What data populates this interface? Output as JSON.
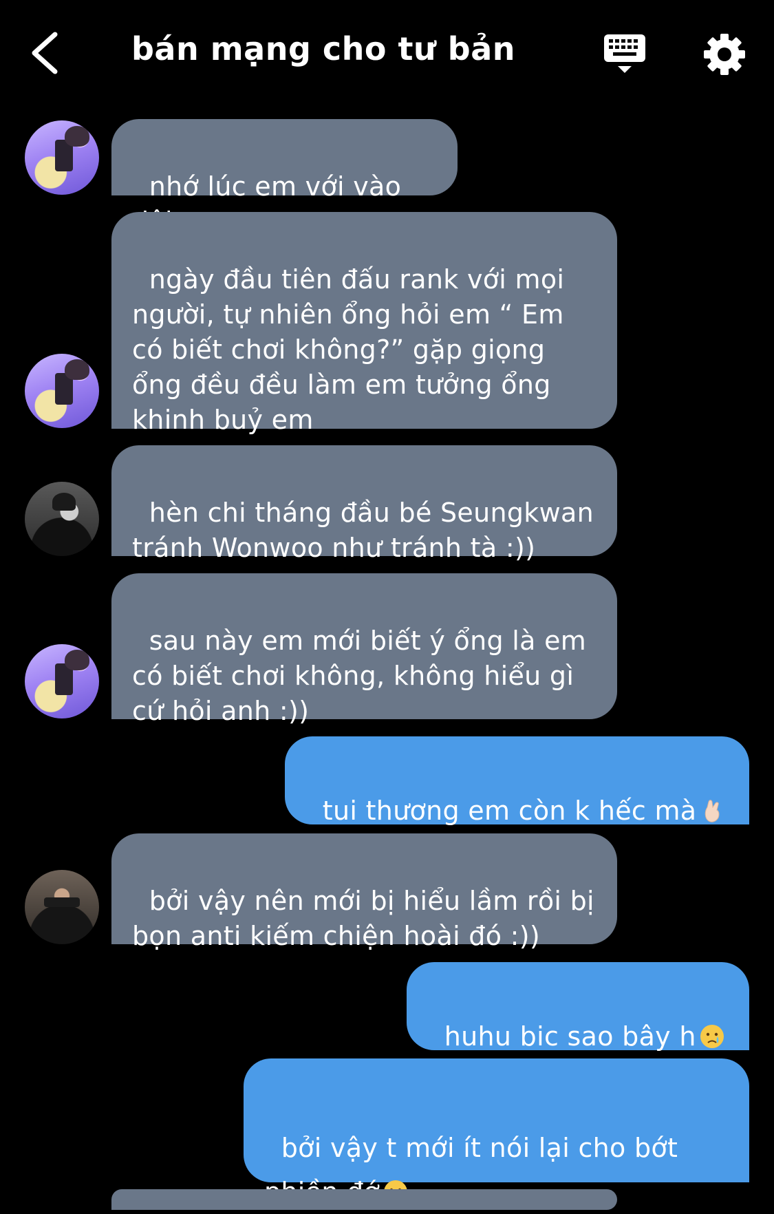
{
  "header": {
    "title": "bán mạng cho tư bản",
    "icons": [
      "back-chevron-icon",
      "keyboard-icon",
      "gear-icon"
    ]
  },
  "messages": [
    {
      "side": "in",
      "text": "nhớ lúc em với vào đội"
    },
    {
      "side": "in",
      "text": "ngày đầu tiên đấu rank với mọi\nngười, tự nhiên ổng hỏi em “ Em\ncó biết chơi không?” gặp giọng\nổng đều đều làm em tưởng ổng\nkhinh buỷ em"
    },
    {
      "side": "in",
      "text": "hèn chi tháng đầu bé Seungkwan\ntránh Wonwoo như tránh tà :))"
    },
    {
      "side": "in",
      "text": "sau này em mới biết ý ổng là em\ncó biết chơi không, không hiểu gì\ncứ hỏi anh :))"
    },
    {
      "side": "out",
      "text": "tui thương em còn k hếc mà",
      "emoji": "pinched-fingers-emoji"
    },
    {
      "side": "in",
      "text": "bởi vậy nên mới bị hiểu lầm rồi bị\nbọn anti kiếm chiện hoài đó :))"
    },
    {
      "side": "out",
      "text": "huhu bic sao bây h",
      "emoji": "crying-face-emoji"
    },
    {
      "side": "out",
      "text": "bởi vậy t mới ít nói lại cho bớt\nphiền đớ",
      "emoji": "crying-face-emoji"
    }
  ],
  "colors": {
    "background": "#000000",
    "incoming_bubble": "#6a7789",
    "outgoing_bubble": "#4b9be8",
    "text": "#ffffff"
  }
}
